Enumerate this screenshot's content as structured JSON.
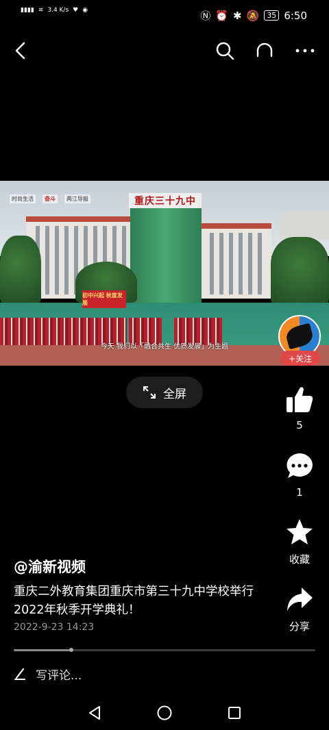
{
  "status_bar": {
    "network_speed": "3.4\nK/s",
    "network_speed_display": "3.4 K/s",
    "battery": "35",
    "time": "6:50"
  },
  "top_nav": {
    "icons": [
      "back-icon",
      "search-icon",
      "headphones-icon",
      "more-icon"
    ]
  },
  "video": {
    "school_sign": "重庆三十九中",
    "stage_banner": "初中兴起 秋度发展",
    "subtitle": "今天 我们以「融合共生 优质发展」为主题",
    "corner_logos": [
      "时尚生活",
      "奋斗",
      "两江导报"
    ]
  },
  "fullscreen": {
    "label": "全屏"
  },
  "author_panel": {
    "follow_label": "+关注"
  },
  "actions": {
    "like_count": "5",
    "comment_count": "1",
    "favorite_label": "收藏",
    "share_label": "分享"
  },
  "post": {
    "author": "@渝新视频",
    "description": "重庆二外教育集团重庆市第三十九中学校举行2022年秋季开学典礼！",
    "time": "2022-9-23 14:23"
  },
  "playback": {
    "progress_fraction": 0.19
  },
  "comment": {
    "placeholder": "写评论..."
  },
  "colors": {
    "follow": "#e24747",
    "background": "#000000"
  }
}
